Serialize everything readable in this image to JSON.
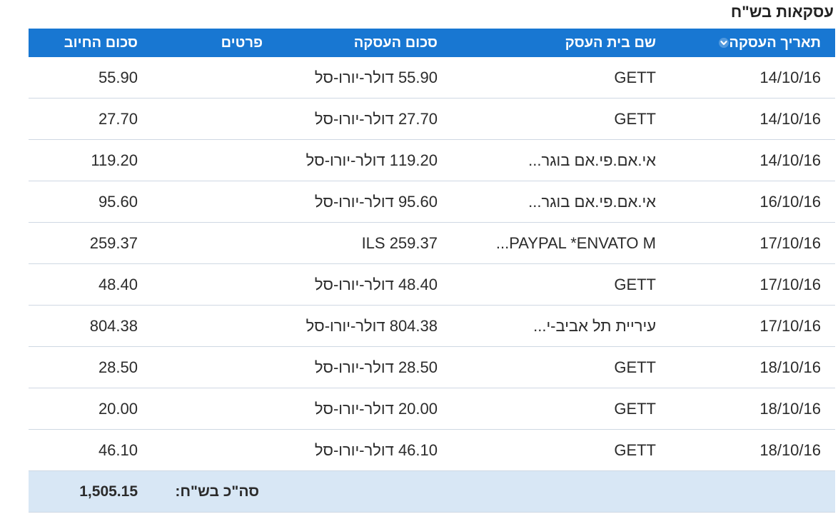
{
  "section_title": "עסקאות בש\"ח",
  "table": {
    "columns": {
      "date": "תאריך העסקה",
      "merchant": "שם בית העסק",
      "amount": "סכום העסקה",
      "details": "פרטים",
      "charge": "סכום החיוב"
    },
    "sort_icon": "chevron-down-icon",
    "rows": [
      {
        "date": "14/10/16",
        "merchant": "GETT",
        "amount": "55.90 דולר-יורו-סל",
        "details": "",
        "charge": "55.90"
      },
      {
        "date": "14/10/16",
        "merchant": "GETT",
        "amount": "27.70 דולר-יורו-סל",
        "details": "",
        "charge": "27.70"
      },
      {
        "date": "14/10/16",
        "merchant": "אי.אם.פי.אם בוגר...",
        "amount": "119.20 דולר-יורו-סל",
        "details": "",
        "charge": "119.20"
      },
      {
        "date": "16/10/16",
        "merchant": "אי.אם.פי.אם בוגר...",
        "amount": "95.60 דולר-יורו-סל",
        "details": "",
        "charge": "95.60"
      },
      {
        "date": "17/10/16",
        "merchant": "PAYPAL *ENVATO M...",
        "amount": "ILS 259.37",
        "details": "",
        "charge": "259.37"
      },
      {
        "date": "17/10/16",
        "merchant": "GETT",
        "amount": "48.40 דולר-יורו-סל",
        "details": "",
        "charge": "48.40"
      },
      {
        "date": "17/10/16",
        "merchant": "עיריית תל אביב-י...",
        "amount": "804.38 דולר-יורו-סל",
        "details": "",
        "charge": "804.38"
      },
      {
        "date": "18/10/16",
        "merchant": "GETT",
        "amount": "28.50 דולר-יורו-סל",
        "details": "",
        "charge": "28.50"
      },
      {
        "date": "18/10/16",
        "merchant": "GETT",
        "amount": "20.00 דולר-יורו-סל",
        "details": "",
        "charge": "20.00"
      },
      {
        "date": "18/10/16",
        "merchant": "GETT",
        "amount": "46.10 דולר-יורו-סל",
        "details": "",
        "charge": "46.10"
      }
    ],
    "footer": {
      "label": "סה\"כ בש\"ח:",
      "total": "1,505.15"
    }
  },
  "colors": {
    "header_bg": "#1877d2",
    "footer_bg": "#d8e7f5",
    "row_border": "#cfd8e3"
  }
}
